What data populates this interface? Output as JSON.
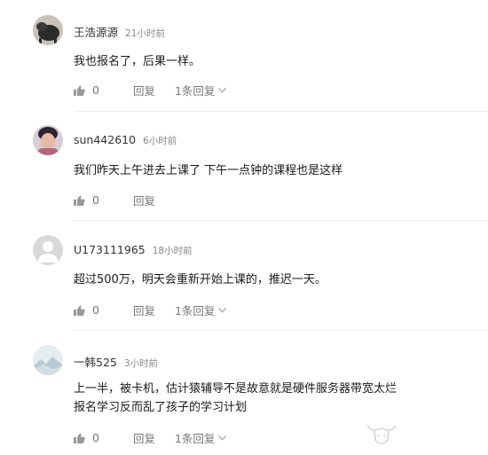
{
  "comments": [
    {
      "username": "王浩源源",
      "time": "21小时前",
      "text": [
        "我也报名了，后果一样。"
      ],
      "likes": "0",
      "reply_label": "回复",
      "replies_label": "1条回复"
    },
    {
      "username": "sun442610",
      "time": "6小时前",
      "text": [
        "我们昨天上午进去上课了 下午一点钟的课程也是这样"
      ],
      "likes": "0",
      "reply_label": "回复"
    },
    {
      "username": "U173111965",
      "time": "18小时前",
      "text": [
        "超过500万，明天会重新开始上课的，推迟一天。"
      ],
      "likes": "0",
      "reply_label": "回复",
      "replies_label": "1条回复"
    },
    {
      "username": "一韩525",
      "time": "3小时前",
      "text": [
        "上一半，被卡机，估计猿辅导不是故意就是硬件服务器带宽太烂",
        "报名学习反而乱了孩子的学习计划"
      ],
      "likes": "0",
      "reply_label": "回复",
      "replies_label": "1条回复"
    }
  ],
  "icons": {
    "like": "thumbs-up-icon",
    "expand": "chevron-down-icon",
    "default_avatar": "default-user-avatar-icon"
  },
  "colors": {
    "meta_text": "#888888",
    "action_text": "#777777",
    "divider": "#ebebeb"
  }
}
